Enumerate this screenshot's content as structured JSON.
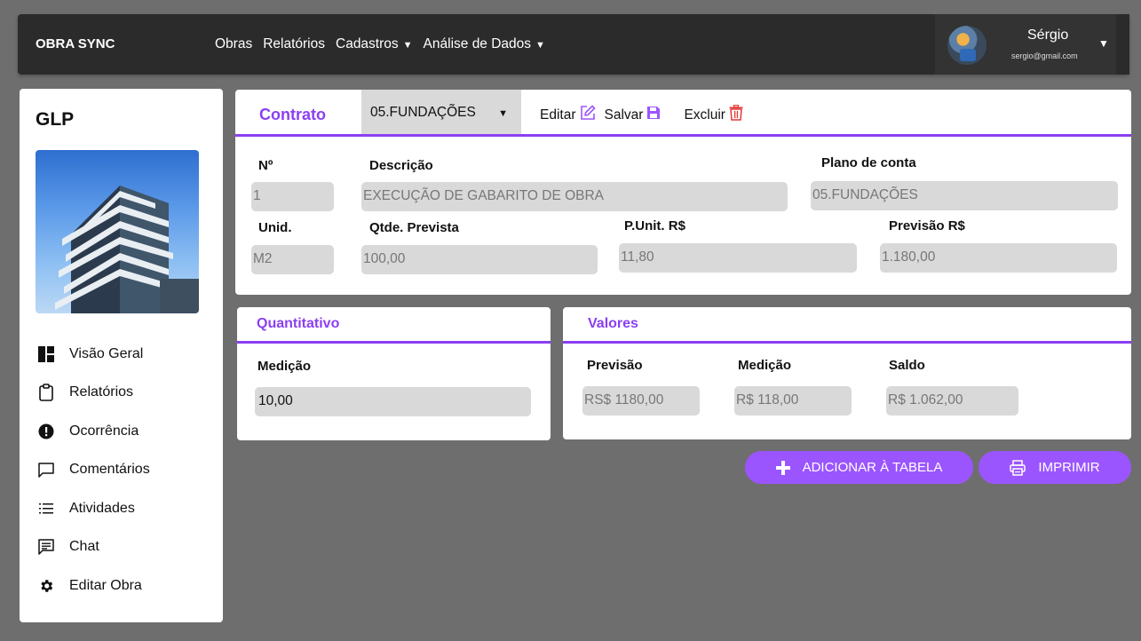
{
  "header": {
    "brand": "OBRA SYNC",
    "nav": [
      {
        "label": "Obras",
        "dropdown": false
      },
      {
        "label": "Relatórios",
        "dropdown": false
      },
      {
        "label": "Cadastros",
        "dropdown": true
      },
      {
        "label": "Análise de Dados",
        "dropdown": true
      }
    ],
    "user": {
      "name": "Sérgio",
      "email": "sergio@gmail.com"
    }
  },
  "sidebar": {
    "title": "GLP",
    "items": [
      {
        "label": "Visão Geral",
        "icon": "dashboard-icon"
      },
      {
        "label": "Relatórios",
        "icon": "clipboard-icon"
      },
      {
        "label": "Ocorrência",
        "icon": "alert-icon"
      },
      {
        "label": "Comentários",
        "icon": "comment-icon"
      },
      {
        "label": "Atividades",
        "icon": "list-icon"
      },
      {
        "label": "Chat",
        "icon": "chat-icon"
      },
      {
        "label": "Editar Obra",
        "icon": "gear-icon"
      }
    ]
  },
  "contract": {
    "title": "Contrato",
    "selected": "05.FUNDAÇÕES",
    "edit_label": "Editar",
    "save_label": "Salvar",
    "delete_label": "Excluir",
    "labels": {
      "number": "Nº",
      "description": "Descrição",
      "account_plan": "Plano de conta",
      "unit": "Unid.",
      "qty_planned": "Qtde. Prevista",
      "unit_price": "P.Unit. R$",
      "forecast": "Previsão R$"
    },
    "values": {
      "number": "1",
      "description": "EXECUÇÃO DE GABARITO DE OBRA",
      "account_plan": "05.FUNDAÇÕES",
      "unit": "M2",
      "qty_planned": "100,00",
      "unit_price": "11,80",
      "forecast": "1.180,00"
    }
  },
  "quantitativo": {
    "title": "Quantitativo",
    "measurement_label": "Medição",
    "measurement_value": "10,00"
  },
  "valores": {
    "title": "Valores",
    "forecast_label": "Previsão",
    "measurement_label": "Medição",
    "balance_label": "Saldo",
    "forecast_value": "RS$ 1180,00",
    "measurement_value": "R$ 118,00",
    "balance_value": "R$ 1.062,00"
  },
  "buttons": {
    "add": "ADICIONAR À TABELA",
    "print": "IMPRIMIR"
  },
  "colors": {
    "accent": "#8b3ff3",
    "button": "#9b55ff",
    "delete": "#e53935",
    "topbar": "#2b2b2b",
    "background": "#6f6e6f"
  }
}
